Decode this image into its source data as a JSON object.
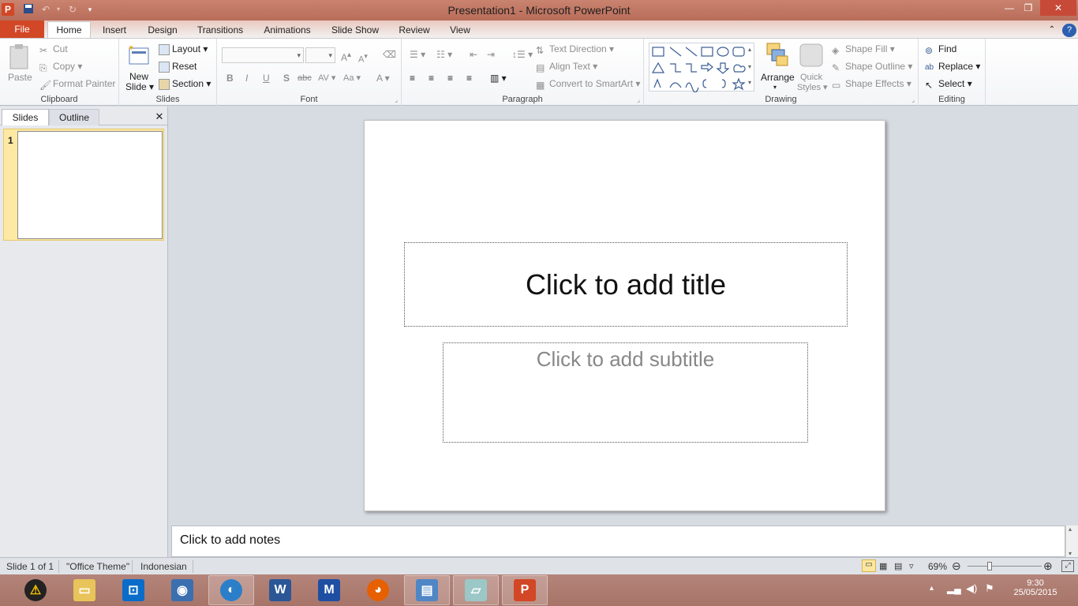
{
  "window": {
    "title": "Presentation1 - Microsoft PowerPoint"
  },
  "tabs": [
    "File",
    "Home",
    "Insert",
    "Design",
    "Transitions",
    "Animations",
    "Slide Show",
    "Review",
    "View"
  ],
  "ribbon": {
    "clipboard": {
      "label": "Clipboard",
      "paste": "Paste",
      "cut": "Cut",
      "copy": "Copy",
      "format_painter": "Format Painter"
    },
    "slides": {
      "label": "Slides",
      "new_slide_1": "New",
      "new_slide_2": "Slide",
      "layout": "Layout",
      "reset": "Reset",
      "section": "Section"
    },
    "font": {
      "label": "Font",
      "bold": "B",
      "italic": "I",
      "underline": "U",
      "shadow": "S",
      "strike": "abc"
    },
    "paragraph": {
      "label": "Paragraph",
      "text_direction": "Text Direction",
      "align_text": "Align Text",
      "convert_smartart": "Convert to SmartArt"
    },
    "drawing": {
      "label": "Drawing",
      "arrange": "Arrange",
      "quick_styles_1": "Quick",
      "quick_styles_2": "Styles",
      "shape_fill": "Shape Fill",
      "shape_outline": "Shape Outline",
      "shape_effects": "Shape Effects"
    },
    "editing": {
      "label": "Editing",
      "find": "Find",
      "replace": "Replace",
      "select": "Select"
    }
  },
  "left_pane": {
    "tab_slides": "Slides",
    "tab_outline": "Outline",
    "slide_number": "1"
  },
  "slide": {
    "title_placeholder": "Click to add title",
    "subtitle_placeholder": "Click to add subtitle"
  },
  "notes": {
    "placeholder": "Click to add notes"
  },
  "statusbar": {
    "slide_info": "Slide 1 of 1",
    "theme": "\"Office Theme\"",
    "language": "Indonesian",
    "zoom": "69%"
  },
  "taskbar": {
    "time": "9:30",
    "date": "25/05/2015"
  },
  "colors": {
    "file_tab": "#d24726",
    "title_bar": "#c07a66",
    "taskbar": "#ac7a6e",
    "selection": "#fde9a3"
  }
}
